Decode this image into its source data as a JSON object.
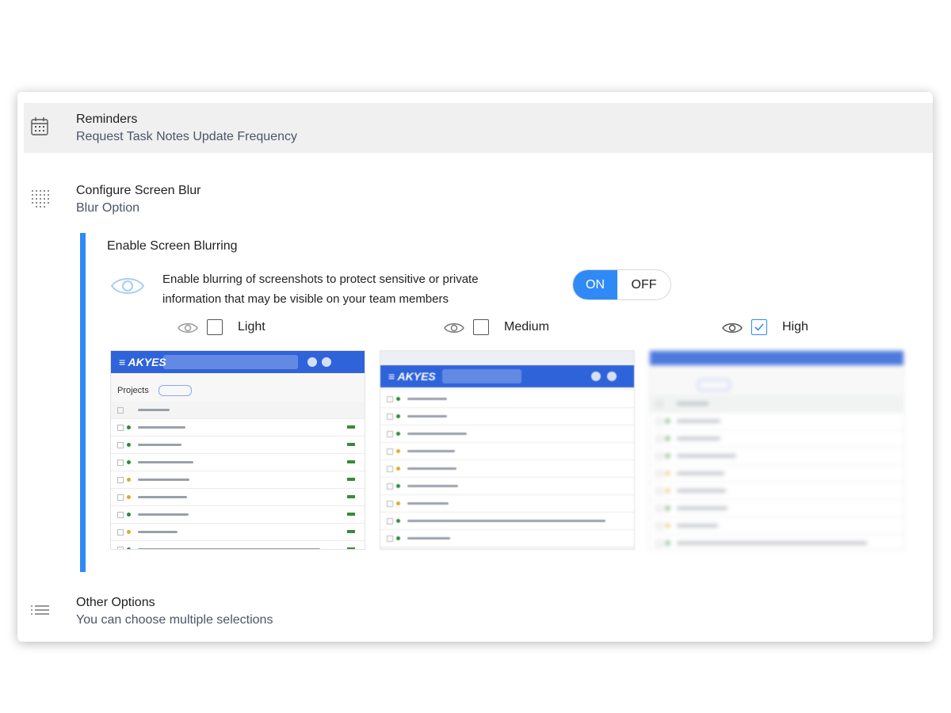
{
  "reminders": {
    "title": "Reminders",
    "subtitle": "Request Task Notes Update Frequency",
    "icon": "calendar-icon"
  },
  "blur_config": {
    "title": "Configure Screen Blur",
    "subtitle": "Blur Option",
    "icon": "grid-dots-icon",
    "enable_title": "Enable Screen Blurring",
    "description": "Enable blurring of screenshots to protect sensitive or private information that may be visible on your team members",
    "toggle": {
      "on_label": "ON",
      "off_label": "OFF",
      "state": "ON"
    },
    "options": [
      {
        "label": "Light",
        "checked": false
      },
      {
        "label": "Medium",
        "checked": false
      },
      {
        "label": "High",
        "checked": true
      }
    ],
    "accent_color": "#2f8af5"
  },
  "other_options": {
    "title": "Other Options",
    "subtitle": "You can choose multiple selections",
    "icon": "list-icon"
  }
}
